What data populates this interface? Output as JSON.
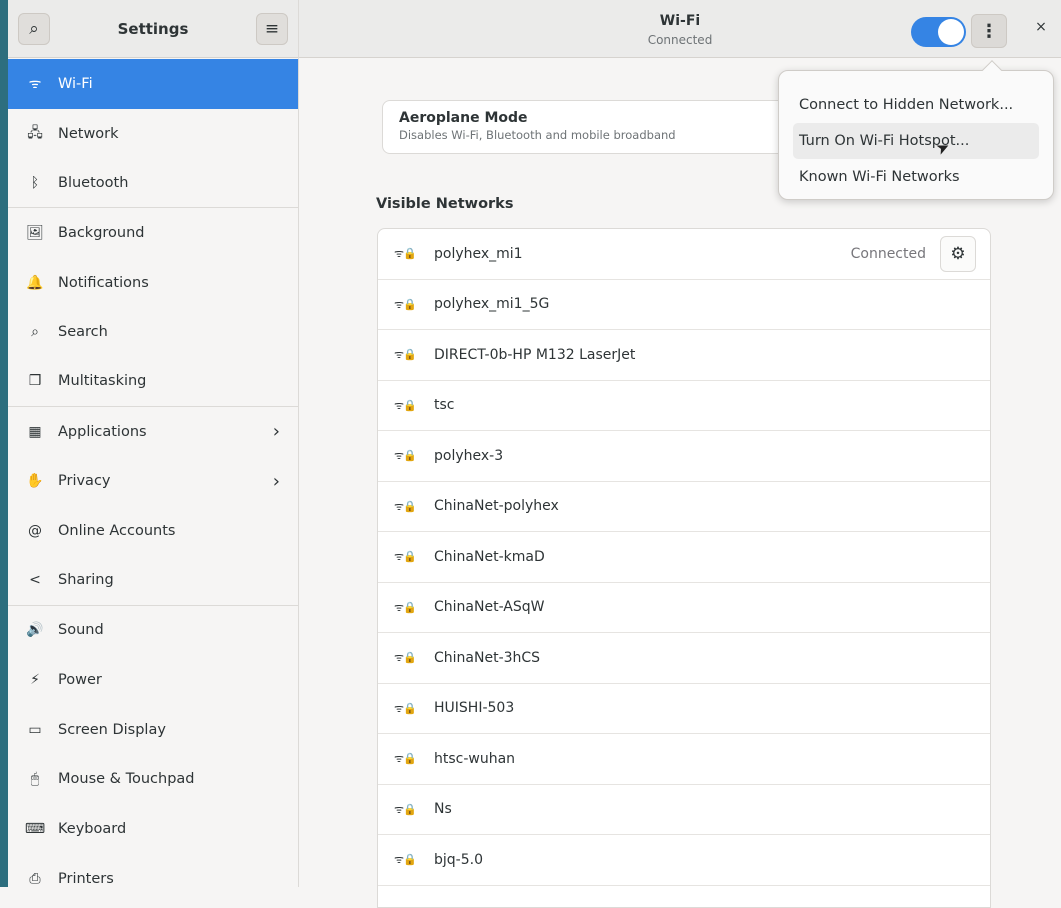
{
  "sidebar": {
    "title": "Settings",
    "items": [
      {
        "label": "Wi-Fi",
        "icon": "wifi-icon",
        "glyph": "ᯤ"
      },
      {
        "label": "Network",
        "icon": "network-icon",
        "glyph": "🖧"
      },
      {
        "label": "Bluetooth",
        "icon": "bluetooth-icon",
        "glyph": "ᛒ"
      },
      {
        "label": "Background",
        "icon": "background-icon",
        "glyph": "🖼"
      },
      {
        "label": "Notifications",
        "icon": "bell-icon",
        "glyph": "🔔"
      },
      {
        "label": "Search",
        "icon": "search-icon",
        "glyph": "⌕"
      },
      {
        "label": "Multitasking",
        "icon": "multitasking-icon",
        "glyph": "❒"
      },
      {
        "label": "Applications",
        "icon": "apps-icon",
        "glyph": "▦"
      },
      {
        "label": "Privacy",
        "icon": "hand-icon",
        "glyph": "✋"
      },
      {
        "label": "Online Accounts",
        "icon": "at-icon",
        "glyph": "@"
      },
      {
        "label": "Sharing",
        "icon": "share-icon",
        "glyph": "<"
      },
      {
        "label": "Sound",
        "icon": "speaker-icon",
        "glyph": "🔊"
      },
      {
        "label": "Power",
        "icon": "power-icon",
        "glyph": "⚡"
      },
      {
        "label": "Screen Display",
        "icon": "display-icon",
        "glyph": "▭"
      },
      {
        "label": "Mouse & Touchpad",
        "icon": "mouse-icon",
        "glyph": "🖱"
      },
      {
        "label": "Keyboard",
        "icon": "keyboard-icon",
        "glyph": "⌨"
      },
      {
        "label": "Printers",
        "icon": "printer-icon",
        "glyph": "⎙"
      }
    ]
  },
  "header": {
    "title": "Wi-Fi",
    "subtitle": "Connected",
    "search_glyph": "⌕",
    "menu_glyph": "≡",
    "kebab_glyph": "⋮",
    "close_glyph": "×"
  },
  "airplane": {
    "title": "Aeroplane Mode",
    "subtitle": "Disables Wi-Fi, Bluetooth and mobile broadband"
  },
  "networks": {
    "heading": "Visible Networks",
    "items": [
      {
        "name": "polyhex_mi1",
        "status": "Connected"
      },
      {
        "name": "polyhex_mi1_5G"
      },
      {
        "name": "DIRECT-0b-HP M132 LaserJet"
      },
      {
        "name": "tsc"
      },
      {
        "name": "polyhex-3"
      },
      {
        "name": "ChinaNet-polyhex"
      },
      {
        "name": "ChinaNet-kmaD"
      },
      {
        "name": "ChinaNet-ASqW"
      },
      {
        "name": "ChinaNet-3hCS"
      },
      {
        "name": "HUISHI-503"
      },
      {
        "name": "htsc-wuhan"
      },
      {
        "name": "Ns"
      },
      {
        "name": "bjq-5.0"
      }
    ]
  },
  "menu": {
    "items": [
      "Connect to Hidden Network...",
      "Turn On Wi-Fi Hotspot...",
      "Known Wi-Fi Networks"
    ]
  },
  "colors": {
    "accent": "#3584e4"
  }
}
